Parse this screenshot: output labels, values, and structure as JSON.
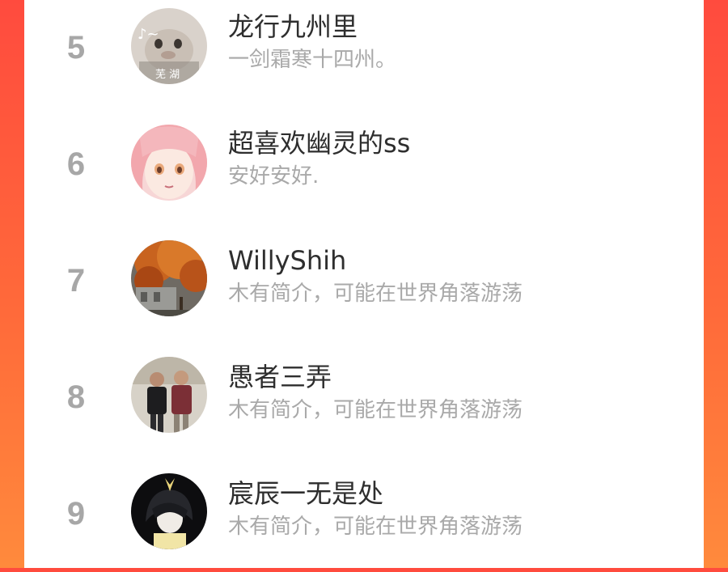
{
  "rank_list": {
    "items": [
      {
        "rank": "5",
        "name": "龙行九州里",
        "bio": "一剑霜寒十四州。",
        "avatar_text": "芜 湖",
        "avatar_note": "♪~"
      },
      {
        "rank": "6",
        "name": "超喜欢幽灵的ss",
        "bio": "安好安好."
      },
      {
        "rank": "7",
        "name": "WillyShih",
        "bio": "木有简介，可能在世界角落游荡"
      },
      {
        "rank": "8",
        "name": "愚者三弄",
        "bio": "木有简介，可能在世界角落游荡"
      },
      {
        "rank": "9",
        "name": "宸辰一无是处",
        "bio": "木有简介，可能在世界角落游荡"
      }
    ]
  },
  "colors": {
    "background_gradient_top": "#ff4b3e",
    "background_gradient_bottom": "#ff8a3c",
    "card": "#ffffff",
    "rank": "#a7a7a7",
    "name": "#2e2e2e",
    "bio": "#a9a9a9"
  }
}
